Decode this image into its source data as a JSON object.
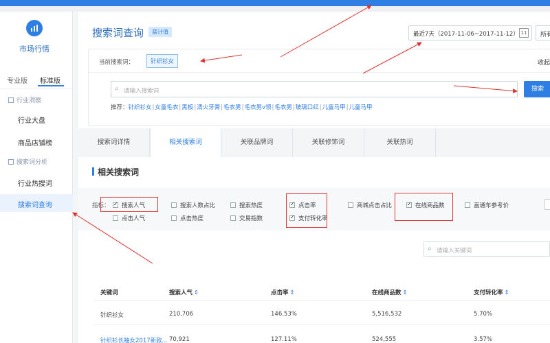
{
  "sidebar": {
    "logo_icon": "chart-icon",
    "app_title": "市场行情",
    "versions": [
      "专业版",
      "标准版"
    ],
    "groups": [
      {
        "label": "行业洞察",
        "items": [
          "行业大盘",
          "商品店铺榜"
        ]
      },
      {
        "label": "搜索词分析",
        "items": [
          "行业热搜词",
          "搜索词查询"
        ]
      }
    ]
  },
  "header": {
    "title": "搜索词查询",
    "badge": "蓝计值",
    "date_range": "最近7天（2017-11-06~2017-11-12）",
    "all_label": "所有"
  },
  "search": {
    "current_label": "当前搜索词：",
    "current_term": "针织衫女",
    "favorite_label": "收起",
    "placeholder": "请输入搜索词",
    "button": "搜索",
    "recommend_label": "推荐：",
    "recommend": [
      "针织衫女",
      "女童毛衣",
      "黑板",
      "清火牙膏",
      "毛衣男",
      "毛衣男v领",
      "毛衣男",
      "玻璃口红",
      "儿童马甲",
      "儿童马甲"
    ]
  },
  "tabs": [
    "搜索词详情",
    "相关搜索词",
    "关联品牌词",
    "关联修饰词",
    "关联热词"
  ],
  "active_tab": 1,
  "section_title": "相关搜索词",
  "filters": {
    "label": "指标：",
    "items": [
      {
        "label": "搜索人气",
        "checked": true
      },
      {
        "label": "点击人气",
        "checked": false
      },
      {
        "label": "搜索人数占比",
        "checked": false
      },
      {
        "label": "点击热度",
        "checked": false
      },
      {
        "label": "搜索热度",
        "checked": false
      },
      {
        "label": "交易指数",
        "checked": false
      },
      {
        "label": "点击率",
        "checked": true
      },
      {
        "label": "支付转化率",
        "checked": true
      },
      {
        "label": "商城点击占比",
        "checked": false
      },
      {
        "label": "在线商品数",
        "checked": true
      },
      {
        "label": "直通车参考价",
        "checked": false
      }
    ]
  },
  "keyword_search": {
    "placeholder": "请输入关键词"
  },
  "table": {
    "columns": [
      "关键词",
      "搜索人气",
      "点击率",
      "在线商品数",
      "支付转化率"
    ],
    "sortable": [
      false,
      true,
      true,
      true,
      true
    ],
    "rows": [
      [
        "针织衫女",
        "210,706",
        "146.53%",
        "5,516,532",
        "5.70%"
      ],
      [
        "针织衫长袖女2017新款...",
        "70,921",
        "127.11%",
        "524,555",
        "3.57%"
      ]
    ]
  },
  "colors": {
    "accent": "#2f7ee3",
    "annotation": "#d33333"
  }
}
